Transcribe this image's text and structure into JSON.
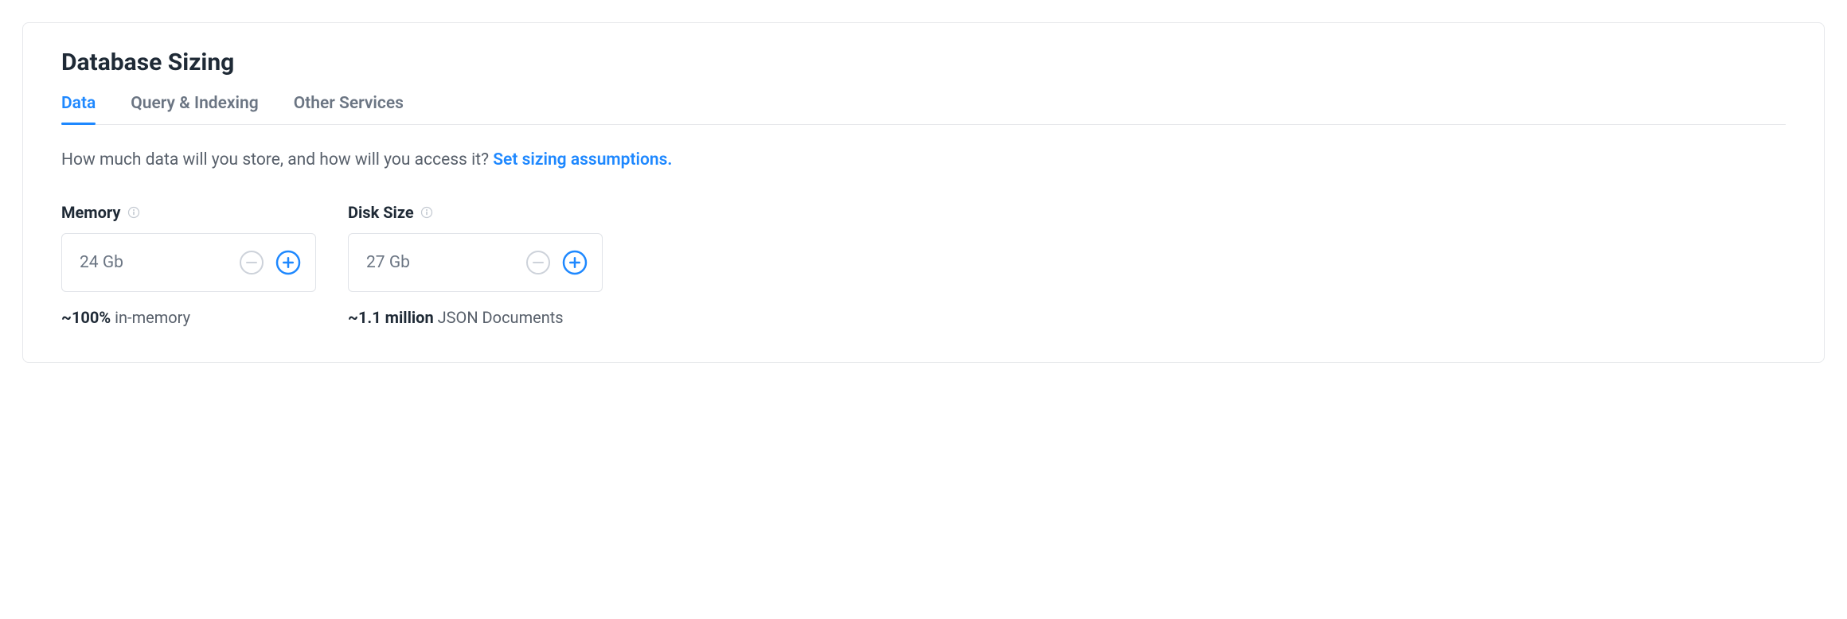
{
  "title": "Database Sizing",
  "tabs": [
    {
      "label": "Data",
      "active": true
    },
    {
      "label": "Query & Indexing",
      "active": false
    },
    {
      "label": "Other Services",
      "active": false
    }
  ],
  "prompt": {
    "text": "How much data will you store, and how will you access it? ",
    "link": "Set sizing assumptions."
  },
  "fields": {
    "memory": {
      "label": "Memory",
      "value": "24 Gb",
      "hint_bold": "~100%",
      "hint_text": " in-memory"
    },
    "disk": {
      "label": "Disk Size",
      "value": "27 Gb",
      "hint_bold": "~1.1 million",
      "hint_text": " JSON Documents"
    }
  },
  "colors": {
    "accent": "#1e88ff",
    "muted": "#b8bec7"
  }
}
